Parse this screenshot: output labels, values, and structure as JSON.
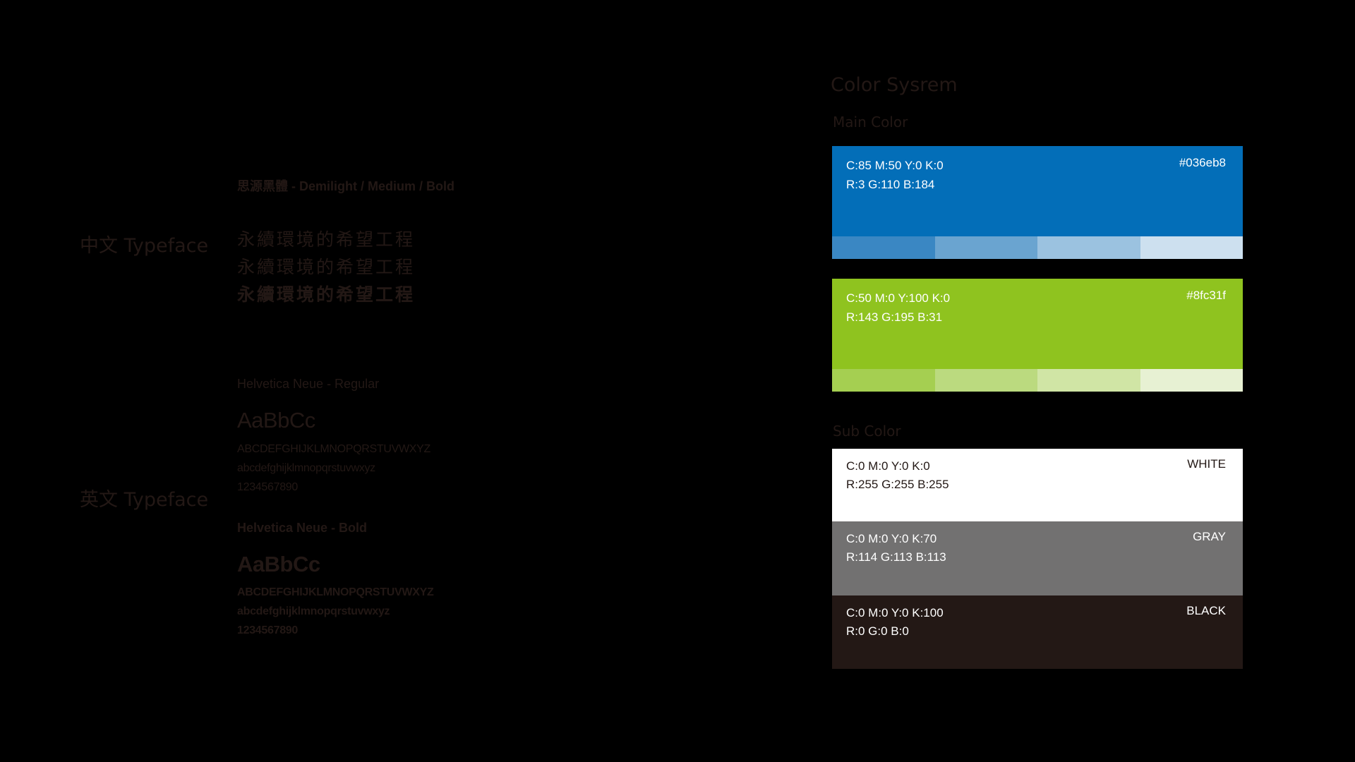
{
  "typeface": {
    "zh_label": "中文 Typeface",
    "en_label": "英文 Typeface",
    "zh_font_heading": "思源黑體 - Demilight / Medium / Bold",
    "zh_samples": [
      "永續環境的希望工程",
      "永續環境的希望工程",
      "永續環境的希望工程"
    ],
    "regular": {
      "heading": "Helvetica Neue - Regular",
      "big": "AaBbCc",
      "upper": "ABCDEFGHIJKLMNOPQRSTUVWXYZ",
      "lower": "abcdefghijklmnopqrstuvwxyz",
      "digits": "1234567890"
    },
    "bold": {
      "heading": "Helvetica Neue - Bold",
      "big": "AaBbCc",
      "upper": "ABCDEFGHIJKLMNOPQRSTUVWXYZ",
      "lower": "abcdefghijklmnopqrstuvwxyz",
      "digits": "1234567890"
    }
  },
  "color_system": {
    "title": "Color Sysrem",
    "main_label": "Main Color",
    "sub_label": "Sub Color",
    "main": [
      {
        "cmyk": "C:85 M:50 Y:0 K:0",
        "rgb": "R:3 G:110 B:184",
        "hex": "#036eb8",
        "color": "#036eb8",
        "tints": [
          "#3a87c3",
          "#6aa4d0",
          "#9bc2e0",
          "#cde0ef"
        ]
      },
      {
        "cmyk": "C:50 M:0 Y:100 K:0",
        "rgb": "R:143 G:195 B:31",
        "hex": "#8fc31f",
        "color": "#8fc31f",
        "tints": [
          "#a5cf51",
          "#bbda7f",
          "#d0e5a5",
          "#e7f1d3"
        ]
      }
    ],
    "sub": [
      {
        "cmyk": "C:0 M:0 Y:0 K:0",
        "rgb": "R:255 G:255 B:255",
        "name": "WHITE",
        "color": "#ffffff",
        "text_color": "#231815"
      },
      {
        "cmyk": "C:0 M:0 Y:0 K:70",
        "rgb": "R:114 G:113 B:113",
        "name": "GRAY",
        "color": "#727171",
        "text_color": "#ffffff"
      },
      {
        "cmyk": "C:0 M:0 Y:0 K:100",
        "rgb": "R:0 G:0 B:0",
        "name": "BLACK",
        "color": "#231815",
        "text_color": "#ffffff"
      }
    ]
  }
}
